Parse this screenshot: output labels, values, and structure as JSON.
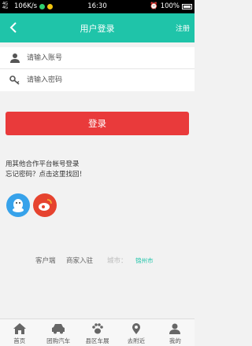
{
  "status_bar": {
    "signal": "4G 4G",
    "speed": "106K/s",
    "time": "16:30",
    "battery": "100%"
  },
  "header": {
    "back_icon": "chevron-left-icon",
    "title": "用户登录",
    "register": "注册"
  },
  "form": {
    "username_placeholder": "请输入账号",
    "password_placeholder": "请输入密码"
  },
  "login_button": "登录",
  "other_login": "用其他合作平台帐号登录",
  "forgot": "忘记密码？点击这里找回！",
  "social": [
    "qq-icon",
    "weibo-icon"
  ],
  "footer_links": {
    "client": "客户端",
    "merchant": "商家入驻",
    "city_label": "城市：",
    "city_value": "锦州市"
  },
  "tabs": [
    {
      "label": "首页",
      "icon": "home-icon"
    },
    {
      "label": "团购汽车",
      "icon": "car-icon"
    },
    {
      "label": "县区车展",
      "icon": "paw-icon"
    },
    {
      "label": "去附近",
      "icon": "location-pin-icon"
    },
    {
      "label": "我的",
      "icon": "user-icon"
    }
  ],
  "colors": {
    "accent": "#1fc4a9",
    "login_button": "#e93a3b",
    "qq": "#37a2ea",
    "weibo": "#e6432f"
  }
}
